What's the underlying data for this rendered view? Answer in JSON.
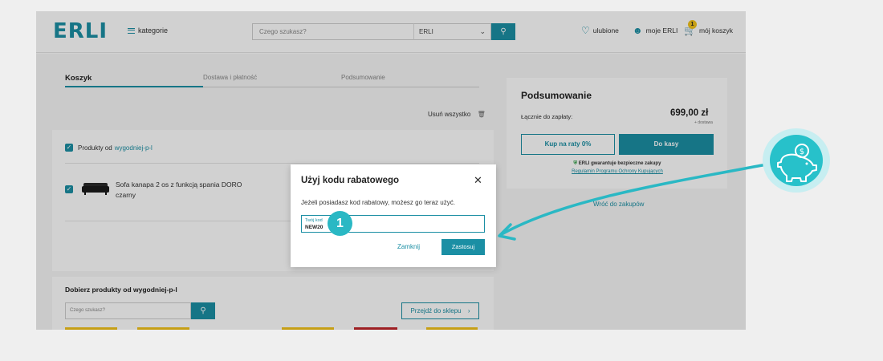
{
  "header": {
    "logo": "ERLI",
    "categories_label": "kategorie",
    "search_placeholder": "Czego szukasz?",
    "search_scope": "ERLI",
    "favorites_label": "ulubione",
    "account_label": "moje ERLI",
    "cart_label": "mój koszyk",
    "cart_count": "1"
  },
  "steps": [
    "Koszyk",
    "Dostawa i płatność",
    "Podsumowanie"
  ],
  "cart": {
    "remove_all_label": "Usuń wszystko",
    "seller_prefix": "Produkty od",
    "seller_name": "wygodniej-p-l",
    "product_name": "Sofa kanapa 2 os z funkcją spania DORO czarny"
  },
  "summary": {
    "title": "Podsumowanie",
    "total_label": "Łącznie do zapłaty:",
    "total_value": "699,00 zł",
    "shipping_note": "+ dostawa",
    "installments_button": "Kup na raty 0%",
    "checkout_button": "Do kasy",
    "guarantee_text": "ERLI gwarantuje bezpieczne zakupy",
    "guarantee_link": "Regulamin Programu Ochrony Kupujących",
    "back_link": "Wróć do zakupów"
  },
  "recommend": {
    "title": "Dobierz produkty od wygodniej-p-l",
    "search_placeholder": "Czego szukasz?",
    "shop_button": "Przejdź do sklepu"
  },
  "modal": {
    "title": "Użyj kodu rabatowego",
    "description": "Jeżeli posiadasz kod rabatowy, możesz go teraz użyć.",
    "field_label": "Twój kod",
    "field_value": "NEW20",
    "close_label": "Zamknij",
    "apply_label": "Zastosuj"
  },
  "callout_number": "1",
  "colors": {
    "accent": "#1b8fa4",
    "callout": "#2ab8c4",
    "badge": "#f2c31c"
  }
}
